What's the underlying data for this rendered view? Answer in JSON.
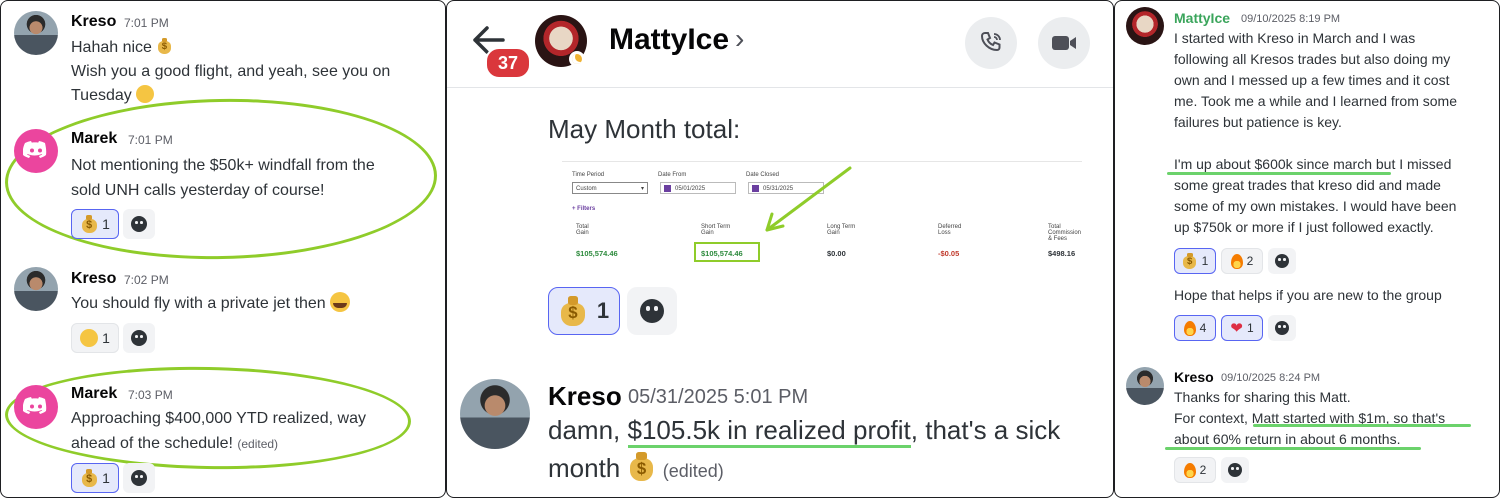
{
  "panel1": {
    "messages": [
      {
        "author": "Kreso",
        "time": "7:01 PM",
        "lines": [
          "Hahah nice",
          "Wish you a good flight, and yeah, see you on",
          "Tuesday"
        ]
      },
      {
        "author": "Marek",
        "time": "7:01 PM",
        "lines": [
          "Not mentioning the $50k+ windfall from the",
          "sold UNH calls yesterday of course!"
        ],
        "reactions": [
          {
            "icon": "money-bag",
            "count": "1"
          }
        ]
      },
      {
        "author": "Kreso",
        "time": "7:02 PM",
        "lines": [
          "You should fly with a private jet then"
        ],
        "reactions": [
          {
            "icon": "laughing-tears",
            "count": "1"
          }
        ]
      },
      {
        "author": "Marek",
        "time": "7:03 PM",
        "lines": [
          "Approaching $400,000 YTD realized, way",
          "ahead of the schedule!"
        ],
        "edited": "(edited)",
        "reactions": [
          {
            "icon": "money-bag",
            "count": "1"
          }
        ]
      }
    ]
  },
  "panel2": {
    "header": {
      "badge": "37",
      "title": "MattyIce",
      "chevron": "›"
    },
    "embed_text": "May Month total:",
    "report": {
      "time_period_label": "Time Period",
      "time_period_value": "Custom",
      "date_from_label": "Date From",
      "date_from_value": "05/01/2025",
      "date_closed_label": "Date Closed",
      "date_closed_value": "05/31/2025",
      "filters": "+ Filters",
      "cols": [
        {
          "label": "Total\nGain",
          "value": "$105,574.46"
        },
        {
          "label": "Short Term\nGain",
          "value": "$105,574.46"
        },
        {
          "label": "Long Term\nGain",
          "value": "$0.00"
        },
        {
          "label": "Deferred\nLoss",
          "value": "-$0.05"
        },
        {
          "label": "Total\nCommission\n& Fees",
          "value": "$498.16"
        }
      ]
    },
    "reaction_count": "1",
    "message": {
      "author": "Kreso",
      "time": "05/31/2025 5:01 PM",
      "line1_pre": "damn, ",
      "line1_hl": "$105.5k in realized profit",
      "line1_post": ", that's a sick",
      "line2": "month",
      "edited": "(edited)"
    }
  },
  "panel3": {
    "msg1": {
      "author": "MattyIce",
      "time": "09/10/2025 8:19 PM",
      "lines": [
        "I started with Kreso in March and I was",
        "following all Kresos trades but also doing my",
        "own and I messed up a few times and it cost",
        "me.  Took me a while and I learned from some",
        "failures but patience is key."
      ],
      "lines2": [
        "I'm up about $600k since march but I missed",
        "some great trades that kreso did and made",
        "some of my own mistakes.  I would have been",
        "up $750k or more if I just followed exactly."
      ],
      "reactions": [
        {
          "icon": "money-bag",
          "count": "1"
        },
        {
          "icon": "fire",
          "count": "2"
        }
      ],
      "line3": "Hope that helps if you are new to the group",
      "reactions2": [
        {
          "icon": "fire",
          "count": "4"
        },
        {
          "icon": "heart",
          "count": "1"
        }
      ]
    },
    "msg2": {
      "author": "Kreso",
      "time": "09/10/2025 8:24 PM",
      "lines": [
        "Thanks for sharing this Matt.",
        "For context, Matt started with $1m, so that's",
        "about 60% return in about 6 months."
      ],
      "reactions": [
        {
          "icon": "fire",
          "count": "2"
        }
      ]
    }
  },
  "colors": {
    "accent_green": "#8fcc2a",
    "underline_green": "#6bd26b",
    "mention_green": "#3ba55c",
    "discord_pink": "#eb459e",
    "badge_red": "#da373c"
  }
}
